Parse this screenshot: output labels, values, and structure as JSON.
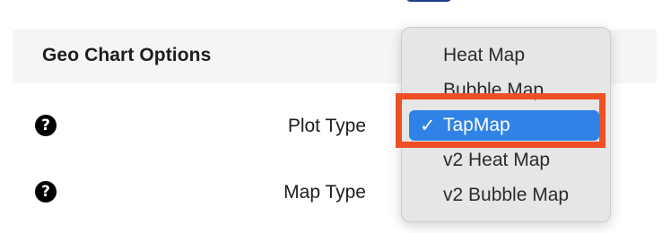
{
  "section": {
    "title": "Geo Chart Options"
  },
  "rows": [
    {
      "label": "Plot Type",
      "help_icon": "?"
    },
    {
      "label": "Map Type",
      "help_icon": "?"
    }
  ],
  "dropdown": {
    "check_mark": "✓",
    "options": [
      {
        "label": "Heat Map",
        "selected": false
      },
      {
        "label": "Bubble Map",
        "selected": false
      },
      {
        "label": "TapMap",
        "selected": true
      },
      {
        "label": "v2 Heat Map",
        "selected": false
      },
      {
        "label": "v2 Bubble Map",
        "selected": false
      }
    ]
  },
  "colors": {
    "selected_highlight": "#2f82e6",
    "annotation_box": "#ee4f25",
    "header_background": "#f5f5f5"
  }
}
